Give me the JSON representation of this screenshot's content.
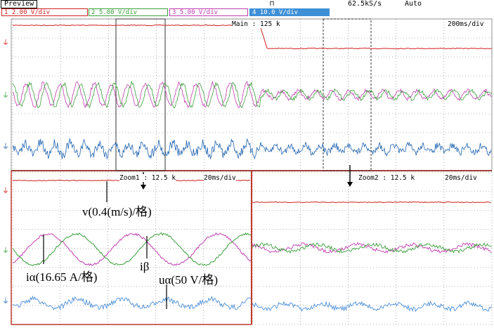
{
  "toolbar": {
    "preview_label": "Preview",
    "trigger_symbol": "⊓",
    "sample_rate": "62.5kS/s",
    "trigger_mode": "Auto"
  },
  "channels": [
    {
      "num": "1",
      "label": "2.00 V/div",
      "color": "#d02020"
    },
    {
      "num": "2",
      "label": "5.00 V/div",
      "color": "#3aa03a"
    },
    {
      "num": "3",
      "label": "5.00 V/div",
      "color": "#c03cb0"
    },
    {
      "num": "4",
      "label": "10.0 V/div",
      "color": "#1f63b0"
    }
  ],
  "main": {
    "label": "Main : 125 k",
    "timebase": "200ms/div"
  },
  "zoom1": {
    "label": "Zoom1 : 12.5 k",
    "timebase": "20ms/div"
  },
  "zoom2": {
    "label": "Zoom2 : 12.5 k",
    "timebase": "20ms/div"
  },
  "annotations": {
    "velocity": "v(0.4(m/s)/格)",
    "i_alpha": "iα(16.65 A/格)",
    "i_beta": "iβ",
    "u_alpha": "uα(50 V/格)"
  },
  "colors": {
    "ch1": "#d02020",
    "ch2": "#3aa03a",
    "ch3": "#c03cb0",
    "ch4": "#1f63b0",
    "grid": "#777777",
    "divider": "#c0392b"
  }
}
